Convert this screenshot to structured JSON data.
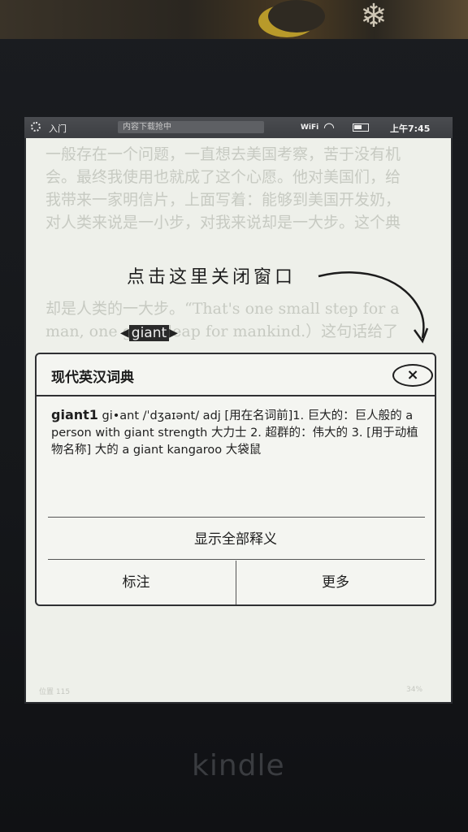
{
  "status_bar": {
    "home_label": "入门",
    "progress_label": "内容下载抢中",
    "wifi_label": "WiFi",
    "time": "上午7:45"
  },
  "book": {
    "lines_top": [
      "一般存在一个问题，一直想去美国考察，苦于没有机",
      "会。最终我使用也就成了这个心愿。他对美国们，给",
      "我带来一家明信片，上面写着：能够到美国开发奶，",
      "对人类来说是一小步，对我来说却是一大步。这个典"
    ],
    "lines_bottom": [
      "却是人类的一大步。“That's one small step for a",
      "man, one giant leap for mankind.）这句话给了"
    ]
  },
  "annotation_text": "点击这里关闭窗口",
  "selected_word": "giant",
  "dialog": {
    "title": "现代英汉词典",
    "close_glyph": "×",
    "headword": "giant1",
    "definition": " gi•ant /ˈdʒaɪənt/ adj [用在名词前]1. 巨大的：巨人般的 a person with giant strength 大力士 2. 超群的：伟大的 3. [用于动植物名称] 大的 a giant kangaroo 大袋鼠",
    "show_all_label": "显示全部释义",
    "left_button_label": "标注",
    "right_button_label": "更多"
  },
  "footer": {
    "left": "位置 115",
    "right": "34%"
  },
  "brand_label": "kindle"
}
